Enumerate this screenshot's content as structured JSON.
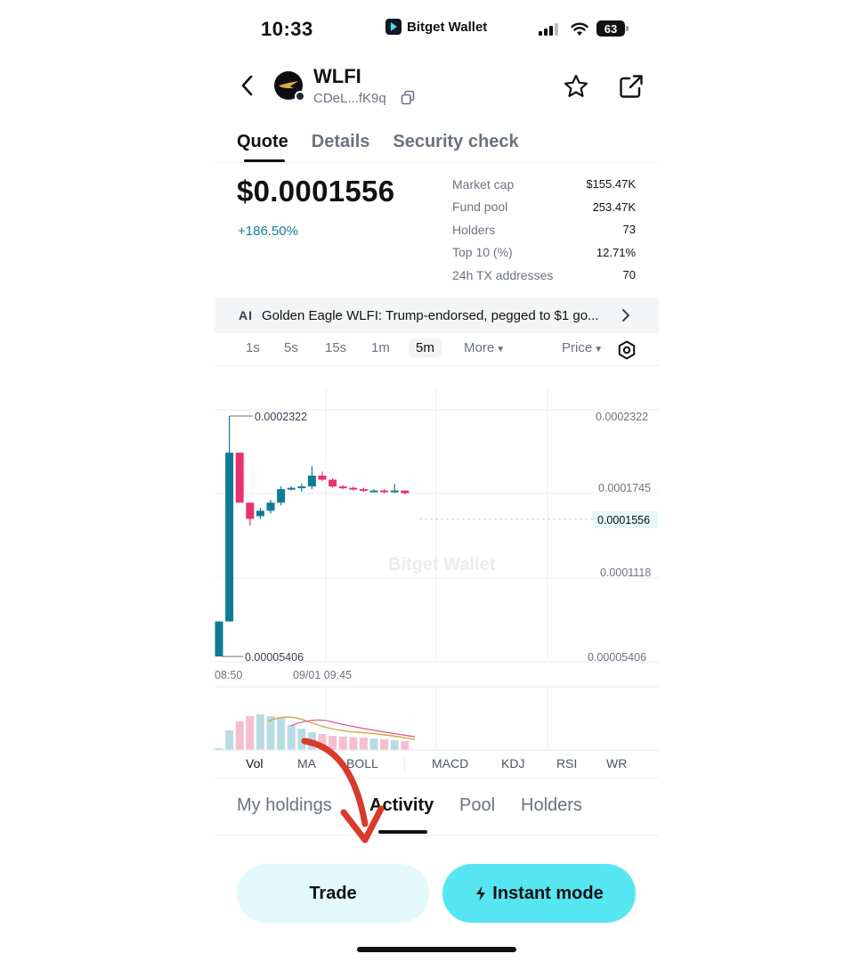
{
  "status_bar": {
    "time": "10:33",
    "brand": "Bitget Wallet",
    "battery": "63"
  },
  "token": {
    "name": "WLFI",
    "address": "CDeL...fK9q"
  },
  "main_tabs": [
    "Quote",
    "Details",
    "Security check"
  ],
  "price": {
    "value": "$0.0001556",
    "change": "+186.50%"
  },
  "stats": [
    {
      "label": "Market cap",
      "value": "$155.47K"
    },
    {
      "label": "Fund pool",
      "value": "253.47K"
    },
    {
      "label": "Holders",
      "value": "73"
    },
    {
      "label": "Top 10 (%)",
      "value": "12.71%"
    },
    {
      "label": "24h TX addresses",
      "value": "70"
    }
  ],
  "ai_banner": {
    "tag": "AI",
    "text": "Golden Eagle WLFI: Trump-endorsed, pegged to $1 go..."
  },
  "timeframes": {
    "items": [
      "1s",
      "5s",
      "15s",
      "1m",
      "5m"
    ],
    "active": "5m",
    "more": "More",
    "price_mode": "Price"
  },
  "chart": {
    "watermark": "Bitget Wallet",
    "high_label": "0.0002322",
    "low_label": "0.00005406",
    "y_ticks": [
      "0.0002322",
      "0.0001745",
      "0.0001118",
      "0.00005406"
    ],
    "current_price_label": "0.0001556",
    "x_ticks": [
      "08:50",
      "09/01 09:45"
    ],
    "up_color": "#0f7c93",
    "down_color": "#e8326e"
  },
  "chart_data": {
    "type": "candlestick",
    "ylim": [
      5.406e-05,
      0.0002322
    ],
    "ohlc": [
      [
        5.406e-05,
        8e-05,
        5.406e-05,
        8e-05
      ],
      [
        8e-05,
        0.0002322,
        8e-05,
        0.000205
      ],
      [
        0.000205,
        0.000205,
        0.000168,
        0.000168
      ],
      [
        0.000168,
        0.000168,
        0.000151,
        0.000156
      ],
      [
        0.000158,
        0.000164,
        0.000156,
        0.000162
      ],
      [
        0.000162,
        0.00017,
        0.00016,
        0.000168
      ],
      [
        0.000168,
        0.00018,
        0.000166,
        0.000178
      ],
      [
        0.000178,
        0.00018,
        0.000177,
        0.000179
      ],
      [
        0.000179,
        0.000182,
        0.000176,
        0.00018
      ],
      [
        0.00018,
        0.000195,
        0.000178,
        0.000188
      ],
      [
        0.000188,
        0.000191,
        0.000184,
        0.000185
      ],
      [
        0.000185,
        0.000186,
        0.000179,
        0.00018
      ],
      [
        0.00018,
        0.000181,
        0.000178,
        0.000179
      ],
      [
        0.000179,
        0.00018,
        0.000177,
        0.000178
      ],
      [
        0.000178,
        0.000179,
        0.000176,
        0.000177
      ],
      [
        0.000177,
        0.000178,
        0.000176,
        0.000177
      ],
      [
        0.000177,
        0.000178,
        0.000175,
        0.000176
      ],
      [
        0.000176,
        0.000182,
        0.000175,
        0.000177
      ],
      [
        0.000177,
        0.000177,
        0.000174,
        0.000175
      ]
    ],
    "volume": [
      0.05,
      0.55,
      0.8,
      0.95,
      1.0,
      0.95,
      0.9,
      0.7,
      0.6,
      0.5,
      0.45,
      0.4,
      0.38,
      0.36,
      0.35,
      0.32,
      0.3,
      0.28,
      0.25
    ]
  },
  "indicators": {
    "items": [
      "Vol",
      "MA",
      "BOLL",
      "MACD",
      "KDJ",
      "RSI",
      "WR"
    ],
    "active": "Vol"
  },
  "bottom_tabs": {
    "items": [
      "My holdings",
      "Activity",
      "Pool",
      "Holders"
    ],
    "active": "Activity"
  },
  "actions": {
    "trade": "Trade",
    "instant": "Instant mode"
  },
  "colors": {
    "accent": "#55e6f2",
    "trade_bg": "#e3f8fb",
    "annotation_arrow": "#d93a2b"
  }
}
